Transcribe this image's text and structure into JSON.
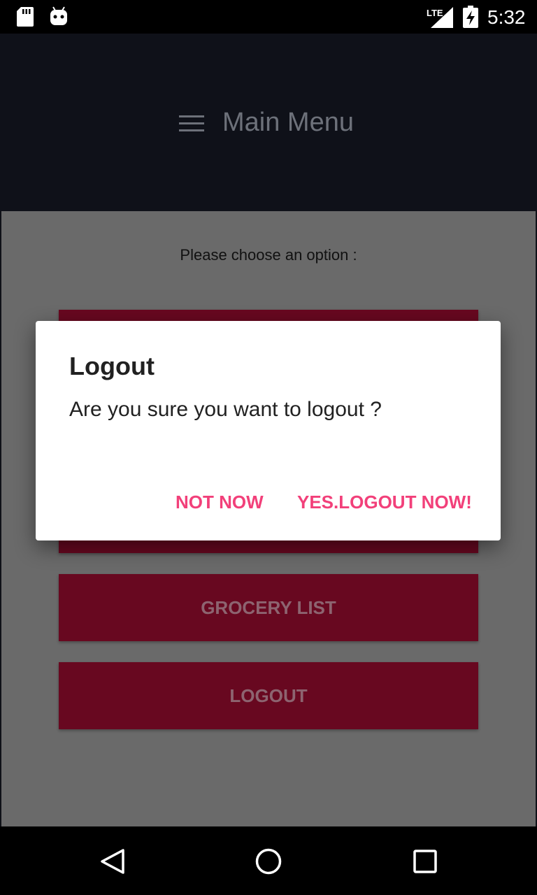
{
  "status_bar": {
    "network_label": "LTE",
    "time": "5:32",
    "icons": [
      "sd-card-icon",
      "android-debug-icon",
      "signal-icon",
      "battery-charging-icon"
    ]
  },
  "app_bar": {
    "title": "Main Menu",
    "menu_icon": "hamburger-menu-icon"
  },
  "main": {
    "prompt": "Please choose an option :",
    "buttons": [
      {
        "label": ""
      },
      {
        "label": "GROCERY LIST"
      },
      {
        "label": "LOGOUT"
      }
    ]
  },
  "dialog": {
    "title": "Logout",
    "message": "Are you sure you want to logout ?",
    "negative_label": "NOT NOW",
    "positive_label": "YES.LOGOUT NOW!"
  },
  "nav_bar": {
    "icons": [
      "back-icon",
      "home-icon",
      "recents-icon"
    ]
  },
  "colors": {
    "accent": "#f2407a",
    "button": "#680820",
    "app_bar": "#0f1119",
    "scrim_content": "#6a6a6a"
  }
}
